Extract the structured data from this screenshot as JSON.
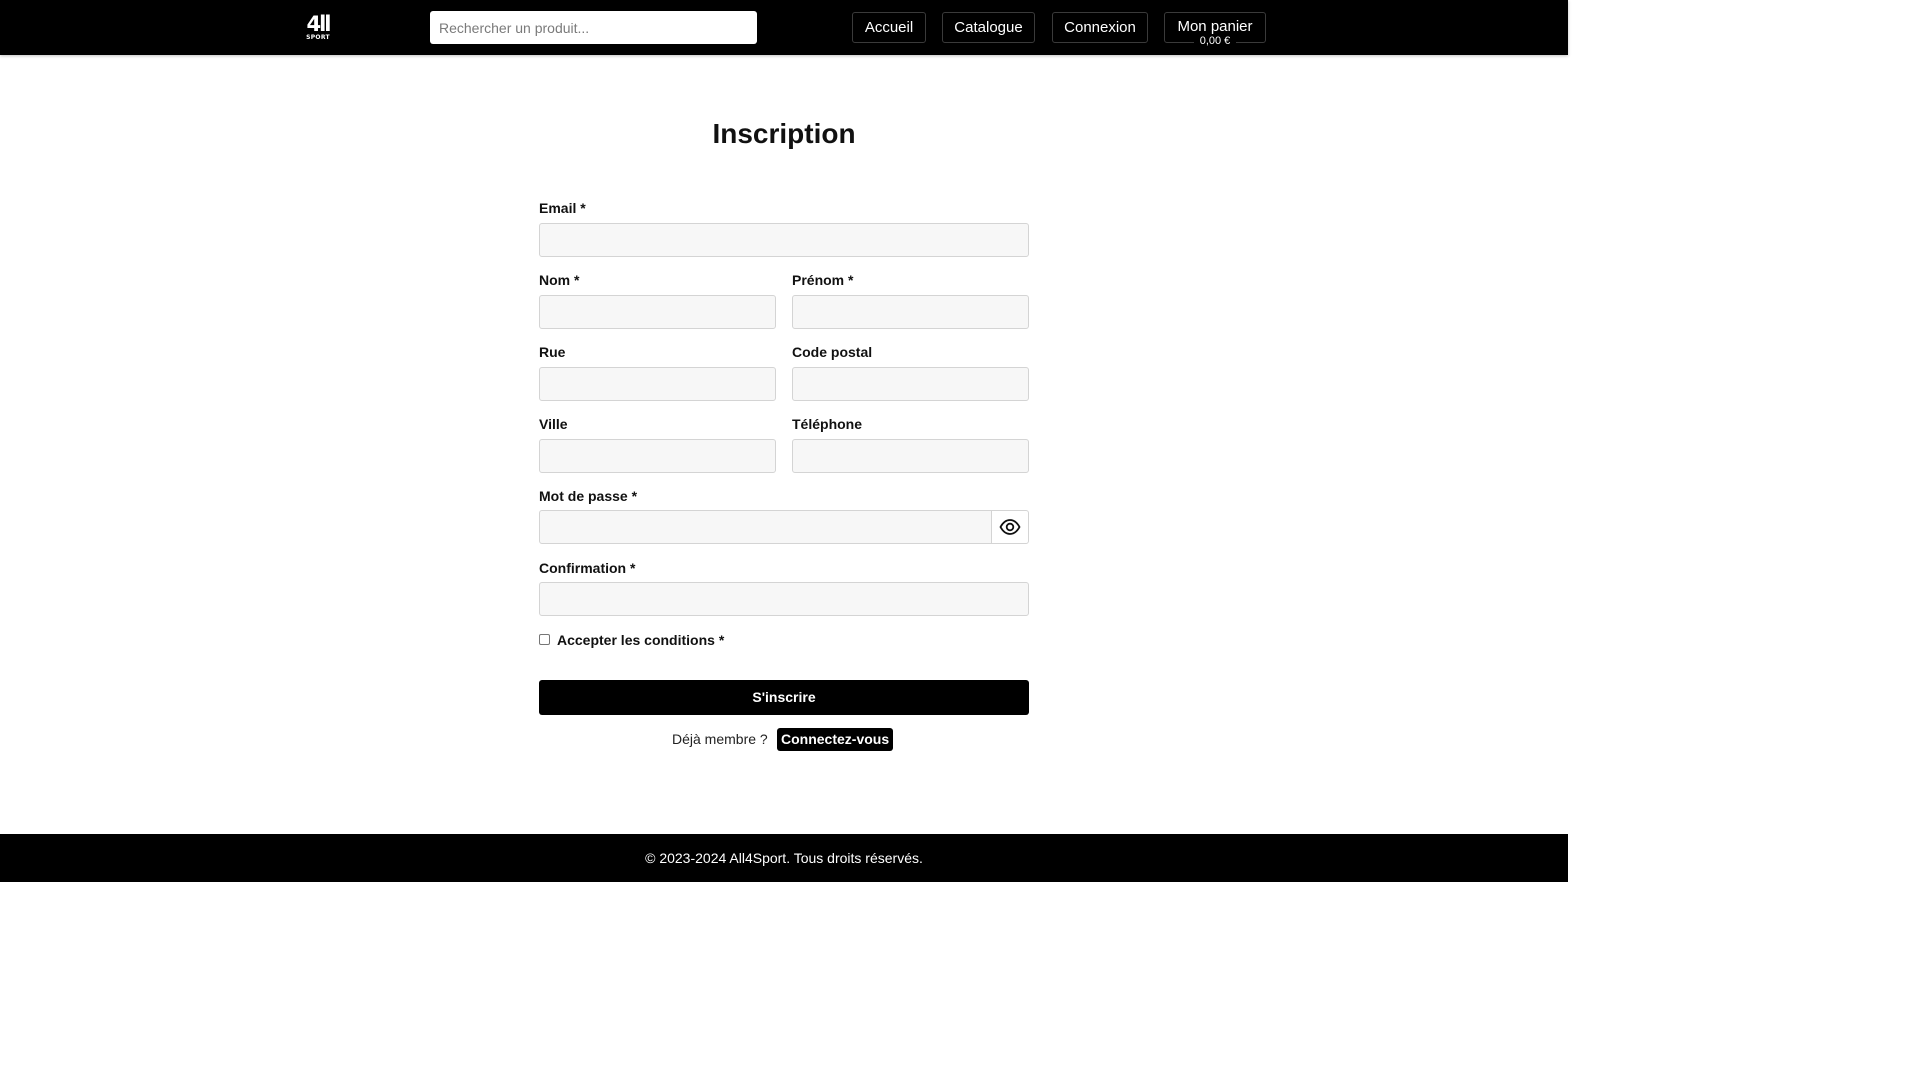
{
  "header": {
    "logo": {
      "main": "4ll",
      "sub": "SPORT"
    },
    "search": {
      "placeholder": "Rechercher un produit..."
    },
    "nav": {
      "home": "Accueil",
      "catalog": "Catalogue",
      "login": "Connexion",
      "cart": "Mon panier",
      "cart_amount": "0,00 €"
    }
  },
  "form": {
    "title": "Inscription",
    "fields": {
      "email": {
        "label": "Email *",
        "value": ""
      },
      "nom": {
        "label": "Nom *",
        "value": ""
      },
      "prenom": {
        "label": "Prénom *",
        "value": ""
      },
      "rue": {
        "label": "Rue",
        "value": ""
      },
      "code_postal": {
        "label": "Code postal",
        "value": ""
      },
      "ville": {
        "label": "Ville",
        "value": ""
      },
      "telephone": {
        "label": "Téléphone",
        "value": ""
      },
      "password": {
        "label": "Mot de passe *",
        "value": ""
      },
      "confirmation": {
        "label": "Confirmation *",
        "value": ""
      }
    },
    "terms": {
      "label": "Accepter les conditions *",
      "checked": false
    },
    "submit_label": "S'inscrire",
    "already_member": "Déjà membre ?",
    "login_link": "Connectez-vous"
  },
  "footer": {
    "copyright": "© 2023-2024 All4Sport. Tous droits réservés."
  },
  "colors": {
    "header_bg": "#000000",
    "field_bg": "#f7f7f7",
    "field_border": "#d4d4d4",
    "accent": "#000000"
  },
  "icons": {
    "password_toggle": "eye-icon"
  }
}
